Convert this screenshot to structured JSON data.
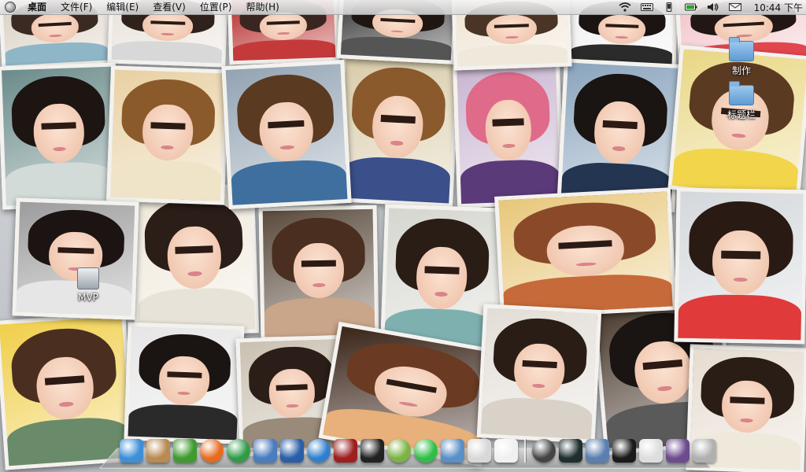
{
  "menubar": {
    "apple_icon": "apple-logo-icon",
    "items": [
      "桌面",
      "文件(F)",
      "编辑(E)",
      "查看(V)",
      "位置(P)",
      "帮助(H)"
    ],
    "status_icons": [
      "wifi-icon",
      "keyboard-icon",
      "phone-icon",
      "battery-icon",
      "volume-icon",
      "mail-icon"
    ],
    "clock": "10:44 下午"
  },
  "desktop_icons": [
    {
      "type": "folder",
      "label": "制作"
    },
    {
      "type": "folder",
      "label": "标题栏"
    },
    {
      "type": "drive",
      "label": "MVP"
    }
  ],
  "dock": {
    "apps": [
      {
        "name": "finder-icon",
        "color": "#3f8fd8"
      },
      {
        "name": "box-icon",
        "color": "#b98a52"
      },
      {
        "name": "terminal-green-icon",
        "color": "#3f9b2f"
      },
      {
        "name": "firefox-icon",
        "color": "#e56b1f"
      },
      {
        "name": "chrome-icon",
        "color": "#2f9b47"
      },
      {
        "name": "image-viewer-icon",
        "color": "#4a7cbf"
      },
      {
        "name": "movie-clapper-icon",
        "color": "#2a5ea8"
      },
      {
        "name": "music-icon",
        "color": "#2f7fcf"
      },
      {
        "name": "film-strip-icon",
        "color": "#9c2020"
      },
      {
        "name": "qq-penguin-icon",
        "color": "#222222"
      },
      {
        "name": "android-icon",
        "color": "#7cb342"
      },
      {
        "name": "download-icon",
        "color": "#2fbf46"
      },
      {
        "name": "screenshot-icon",
        "color": "#5a8fc7"
      },
      {
        "name": "camera-icon",
        "color": "#d8d8d8"
      },
      {
        "name": "document-icon",
        "color": "#f0f0f0"
      }
    ],
    "utilities": [
      {
        "name": "search-icon",
        "color": "#444444"
      },
      {
        "name": "system-monitor-icon",
        "color": "#1f2f2f"
      },
      {
        "name": "workspace-switcher-icon",
        "color": "#5a7fb0"
      },
      {
        "name": "terminal-icon",
        "color": "#1a1a1a"
      },
      {
        "name": "file-browser-icon",
        "color": "#dddddd"
      },
      {
        "name": "desktop-icon",
        "color": "#6d4b8f"
      },
      {
        "name": "trash-icon",
        "color": "#b0b0b0"
      }
    ]
  },
  "colors": {
    "menubar_bg": "#e6e6e6",
    "wallpaper_base": "#cfd3d6"
  }
}
